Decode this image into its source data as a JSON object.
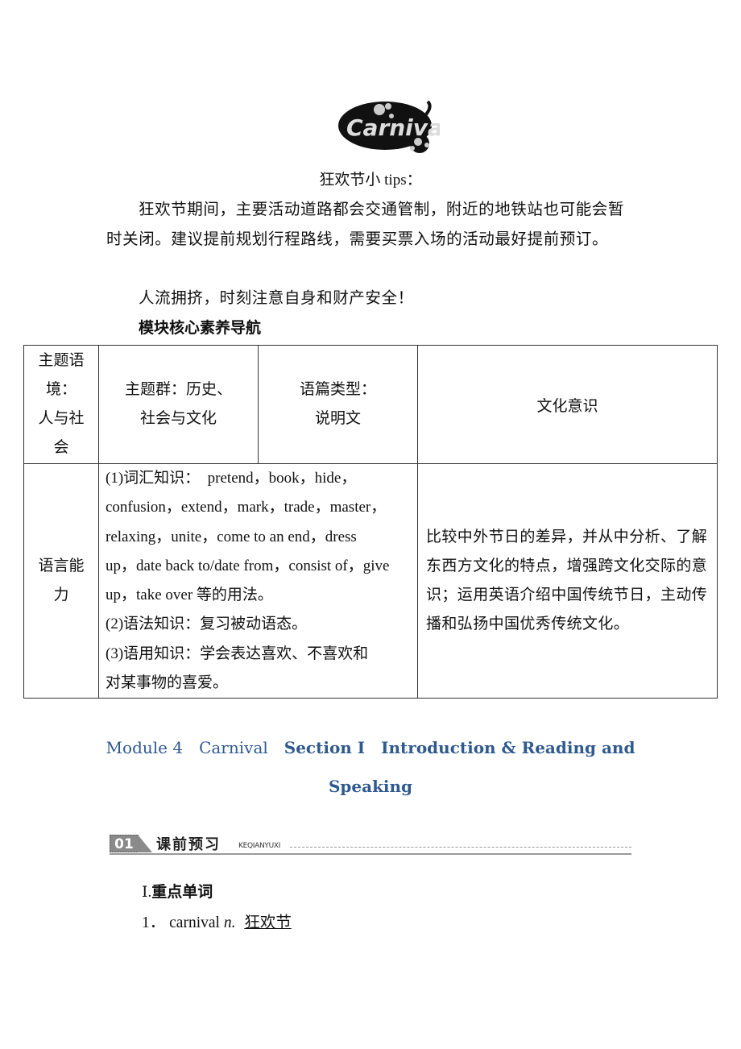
{
  "logo": {
    "text": "Carnival",
    "icon": "carnival-logo-icon"
  },
  "tips": {
    "title": "狂欢节小 tips：",
    "paragraph1": "狂欢节期间，主要活动道路都会交通管制，附近的地铁站也可能会暂时关闭。建议提前规划行程路线，需要买票入场的活动最好提前预订。",
    "paragraph2": "人流拥挤，时刻注意自身和财产安全！"
  },
  "navigation_title": "模块核心素养导航",
  "table": {
    "row1": {
      "theme_context": [
        "主题语",
        "境：",
        "人与社",
        "会"
      ],
      "theme_group": [
        "主题群：历史、",
        "社会与文化"
      ],
      "text_type": [
        "语篇类型：",
        "说明文"
      ],
      "culture_header": "文化意识"
    },
    "row2": {
      "language_ability": [
        "语言能",
        "力"
      ],
      "knowledge_lines": [
        "(1)词汇知识：　pretend，book，hide，",
        "confusion，extend，mark，trade，master，",
        "relaxing，unite，come to an end，dress",
        "up，date back to/date from，consist of，give",
        "up，take over 等的用法。",
        "(2)语法知识：复习被动语态。",
        "(3)语用知识：学会表达喜欢、不喜欢和",
        "对某事物的喜爱。"
      ],
      "culture_text": "比较中外节日的差异，并从中分析、了解东西方文化的特点，增强跨文化交际的意识；运用英语介绍中国传统节日，主动传播和弘扬中国优秀传统文化。"
    }
  },
  "module_heading": {
    "module": "Module 4",
    "topic": "Carnival",
    "section": "Section Ⅰ",
    "title_line1": "Introduction & Reading and",
    "title_line2": "Speaking",
    "color": "#2f5a8f"
  },
  "section_banner": {
    "number": "01",
    "title": "课前预习",
    "pinyin": "KEQIANYUXI"
  },
  "vocab": {
    "heading_num": "Ⅰ.",
    "heading": "重点单词",
    "items": [
      {
        "num": "1．",
        "word": "carnival",
        "pos": "n.",
        "answer": "狂欢节"
      }
    ]
  }
}
